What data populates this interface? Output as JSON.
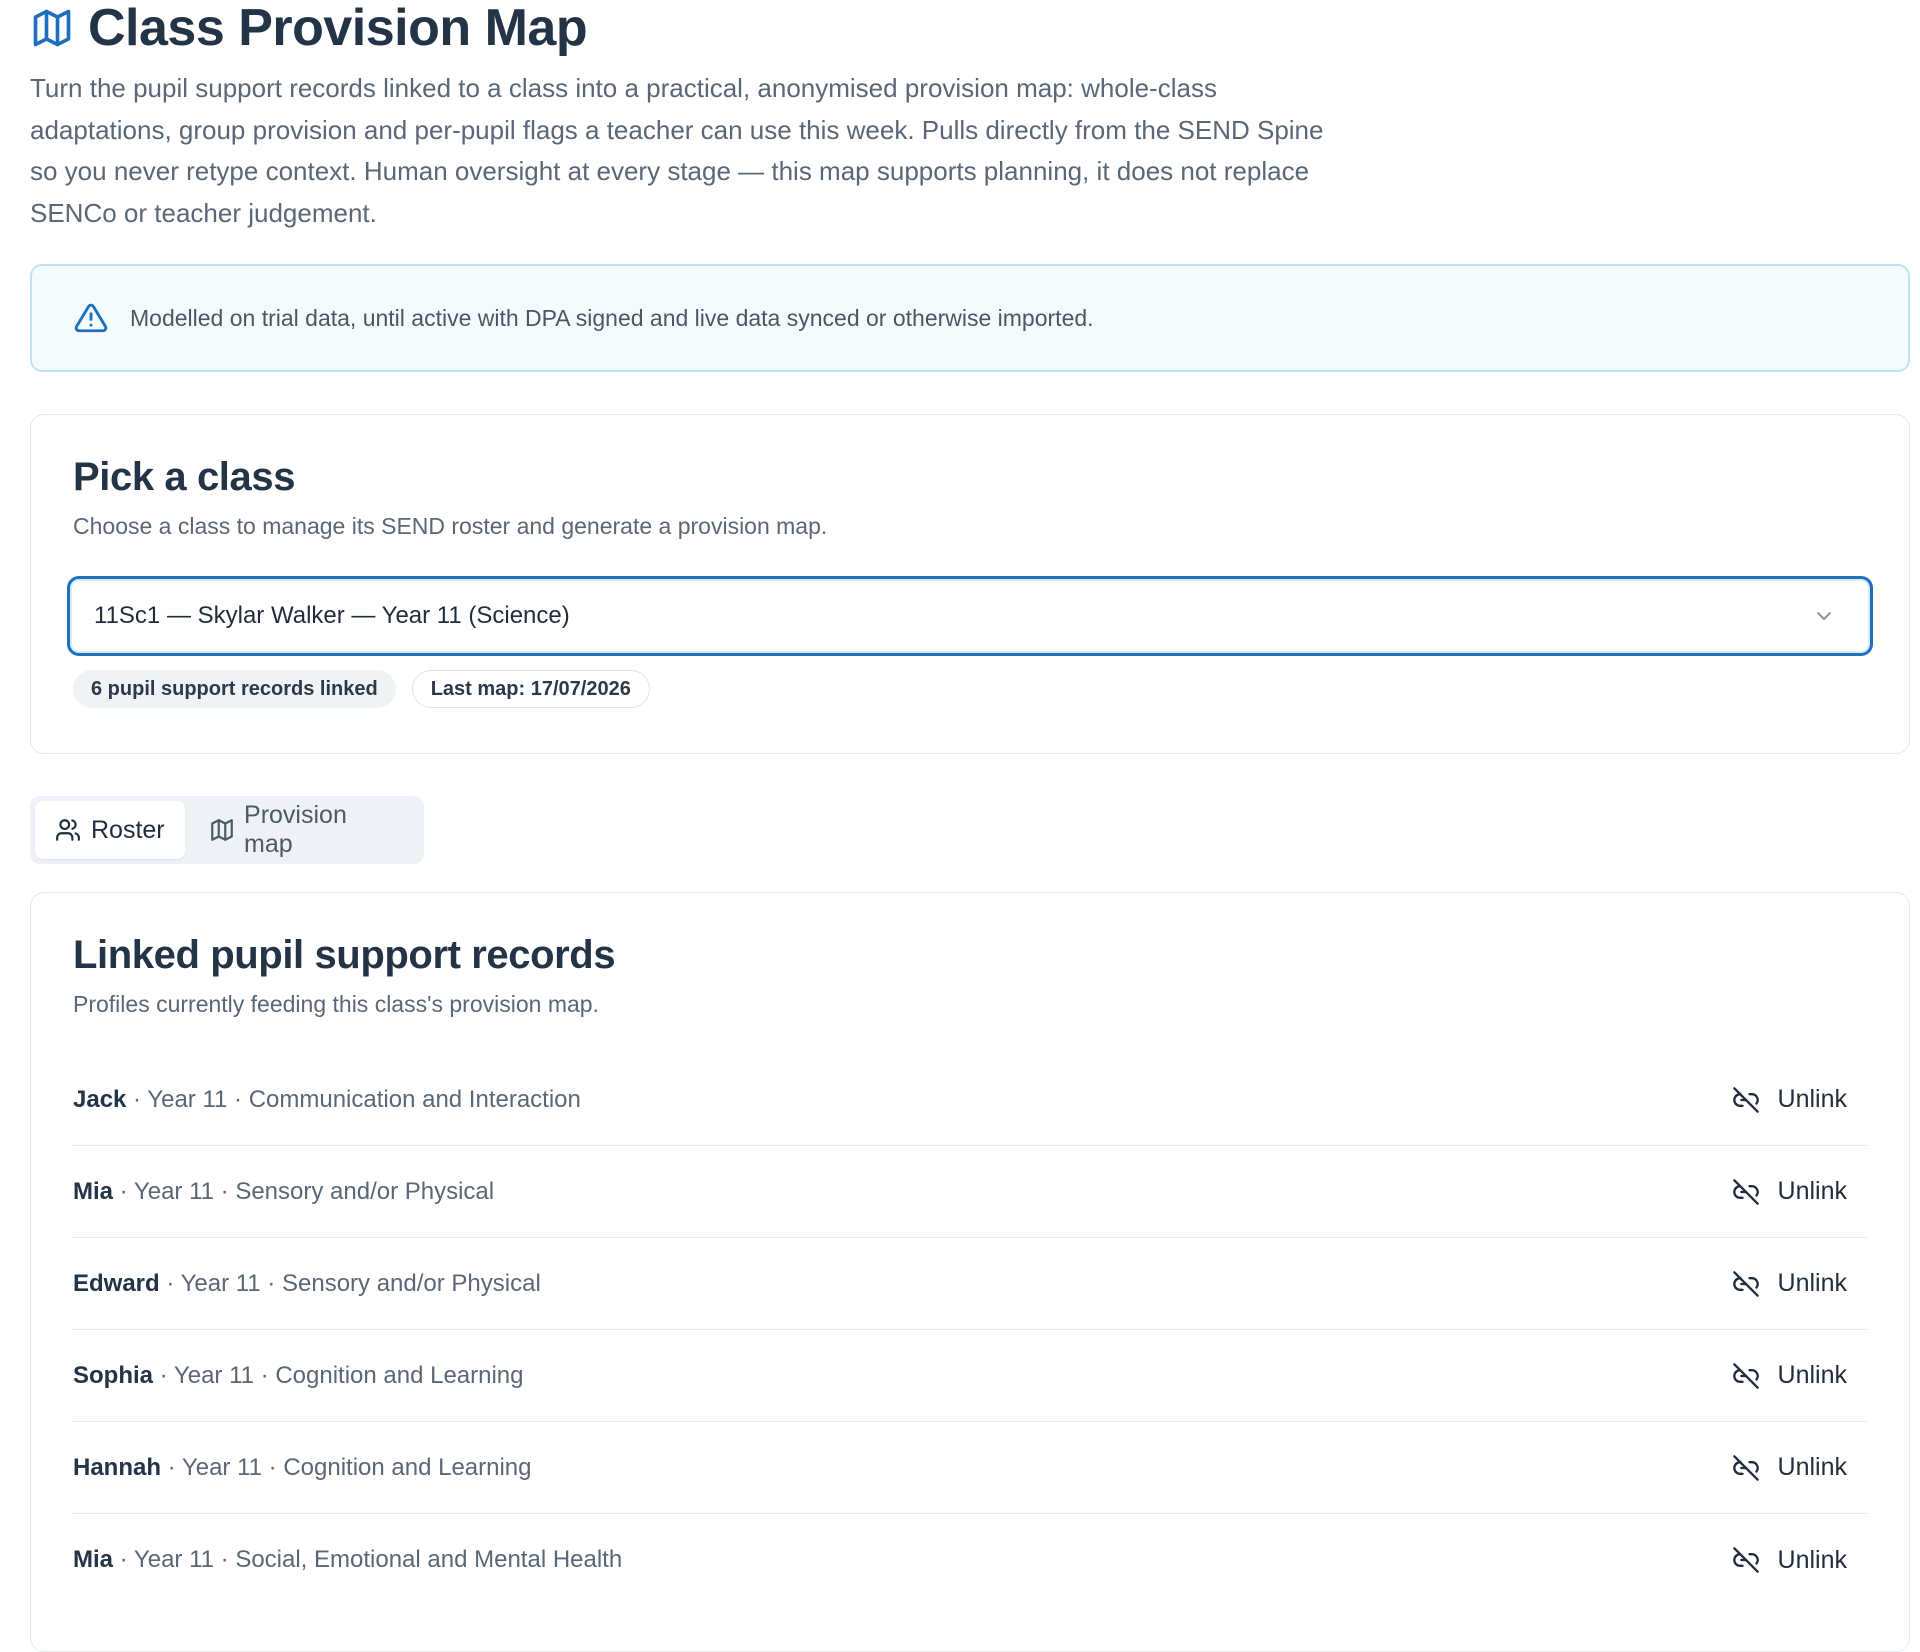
{
  "header": {
    "title": "Class Provision Map",
    "intro": "Turn the pupil support records linked to a class into a practical, anonymised provision map: whole-class adaptations, group provision and per-pupil flags a teacher can use this week. Pulls directly from the SEND Spine so you never retype context. Human oversight at every stage — this map supports planning, it does not replace SENCo or teacher judgement.",
    "icon": "map-icon"
  },
  "notice": {
    "text": "Modelled on trial data, until active with DPA signed and live data synced or otherwise imported.",
    "icon": "warning-triangle-icon"
  },
  "class_picker": {
    "title": "Pick a class",
    "subtitle": "Choose a class to manage its SEND roster and generate a provision map.",
    "selected": "11Sc1 — Skylar Walker — Year 11 (Science)",
    "badges": {
      "linked": "6 pupil support records linked",
      "last_map": "Last map: 17/07/2026"
    }
  },
  "tabs": [
    {
      "label": "Roster",
      "icon": "users-icon",
      "active": true
    },
    {
      "label": "Provision map",
      "icon": "map-icon",
      "active": false
    }
  ],
  "records": {
    "title": "Linked pupil support records",
    "subtitle": "Profiles currently feeding this class's provision map.",
    "unlink_label": "Unlink",
    "items": [
      {
        "name": "Jack",
        "details": " · Year 11 · Communication and Interaction"
      },
      {
        "name": "Mia",
        "details": " · Year 11 · Sensory and/or Physical"
      },
      {
        "name": "Edward",
        "details": " · Year 11 · Sensory and/or Physical"
      },
      {
        "name": "Sophia",
        "details": " · Year 11 · Cognition and Learning"
      },
      {
        "name": "Hannah",
        "details": " · Year 11 · Cognition and Learning"
      },
      {
        "name": "Mia",
        "details": " · Year 11 · Social, Emotional and Mental Health"
      }
    ]
  },
  "colors": {
    "accent": "#1f6fbf",
    "notice_border": "#bfe3ef",
    "notice_bg": "#f4fbfd",
    "text_dark": "#243447",
    "text_muted": "#5a6776"
  }
}
